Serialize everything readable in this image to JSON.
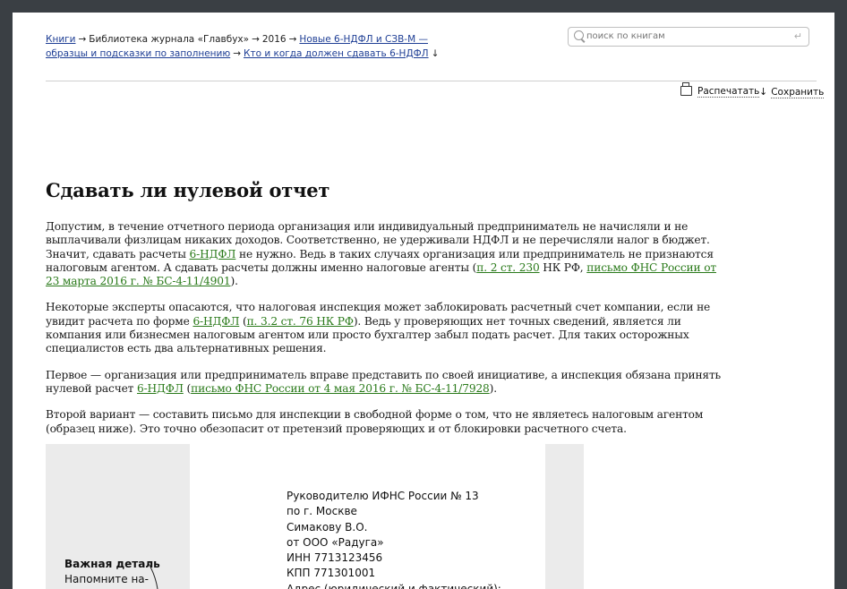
{
  "breadcrumbs": {
    "items": [
      {
        "label": "Книги",
        "link": true
      },
      {
        "label": "Библиотека журнала «Главбух»",
        "link": false
      },
      {
        "label": "2016",
        "link": false
      },
      {
        "label": "Новые 6-НДФЛ и СЗВ-М — образцы и подсказки по заполнению",
        "link": true
      },
      {
        "label": "Кто и когда должен сдавать 6-НДФЛ",
        "link": true
      }
    ],
    "separator": "→",
    "down_arrow": "↓"
  },
  "search": {
    "placeholder": "поиск по книгам",
    "enter_icon": "↵"
  },
  "toolbar": {
    "print_label": "Распечатать",
    "save_label": "Сохранить",
    "save_icon": "↓"
  },
  "article": {
    "title": "Сдавать ли нулевой отчет",
    "p1": {
      "t1": "Допустим, в течение отчетного периода организация или индивидуальный предприниматель не начисляли и не выплачивали физлицам никаких доходов. Соответственно, не удерживали НДФЛ и не перечисляли налог в бюджет. Значит, сдавать расчеты ",
      "l1": "6-НДФЛ",
      "t2": " не нужно. Ведь в таких случаях организация или предприниматель не признаются налоговым агентом. А сдавать расчеты должны именно налоговые агенты (",
      "l2": "п. 2 ст. 230",
      "t3": " НК РФ, ",
      "l3": "письмо ФНС России от 23 марта 2016 г. № БС-4-11/4901",
      "t4": ")."
    },
    "p2": {
      "t1": "Некоторые эксперты опасаются, что налоговая инспекция может заблокировать расчетный счет компании, если не увидит расчета по форме ",
      "l1": "6-НДФЛ",
      "t2": " (",
      "l2": "п. 3.2 ст. 76 НК РФ",
      "t3": "). Ведь у проверяющих нет точных сведений, является ли компания или бизнесмен налоговым агентом или просто бухгалтер забыл подать расчет. Для таких осторожных специалистов есть два альтернативных решения."
    },
    "p3": {
      "t1": "Первое — организация или предприниматель вправе представить по своей инициативе, а инспекция обязана принять нулевой расчет ",
      "l1": "6-НДФЛ",
      "t2": " (",
      "l2": "письмо ФНС России от 4 мая 2016 г. № БС-4-11/7928",
      "t3": ")."
    },
    "p4": "Второй вариант — составить письмо для инспекции в свободной форме о том, что не являетесь налоговым агентом (образец ниже). Это точно обезопасит от претензий проверяющих и от блокировки расчетного счета."
  },
  "sample_letter": {
    "lines": [
      "Руководителю ИФНС России № 13",
      "по г. Москве",
      "Симакову В.О.",
      "от ООО «Радуга»",
      "ИНН 7713123456",
      "КПП 771301001",
      "Адрес (юридический и фактический):"
    ],
    "note_title": "Важная деталь",
    "note_text": "Напомните на-"
  }
}
